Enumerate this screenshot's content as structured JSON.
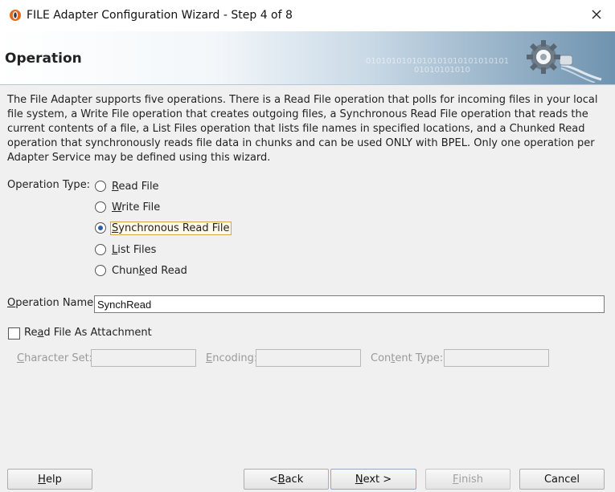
{
  "window": {
    "title": "FILE Adapter Configuration Wizard - Step 4 of 8"
  },
  "banner": {
    "title": "Operation",
    "binary": "0101010101010101010101010101",
    "binary2": "01010101010"
  },
  "description": "The File Adapter supports five operations.  There is a Read File operation that polls for incoming files in your local file system, a Write File operation that creates outgoing files, a Synchronous Read File operation that reads the current contents of a file, a List Files operation that lists file names in specified locations, and a Chunked Read operation that synchronously reads file data in chunks and can be used ONLY with BPEL. Only one operation per Adapter Service may be defined using this wizard.",
  "operation_type": {
    "label": "Operation Type:",
    "selected": "Synchronous Read File",
    "options": [
      {
        "mn": "R",
        "rest": "ead File"
      },
      {
        "mn": "W",
        "rest": "rite File"
      },
      {
        "mn": "S",
        "rest": "ynchronous Read File"
      },
      {
        "mn": "L",
        "rest": "ist Files"
      },
      {
        "pre": "Chun",
        "mn": "k",
        "rest": "ed Read"
      }
    ]
  },
  "operation_name": {
    "label_mn": "O",
    "label_rest": "peration Name:",
    "value": "SynchRead"
  },
  "attachment": {
    "label_pre": "Re",
    "label_mn": "a",
    "label_rest": "d File As Attachment",
    "checked": false
  },
  "character_set": {
    "label_mn": "C",
    "label_rest": "haracter Set:",
    "value": ""
  },
  "encoding": {
    "label_mn": "E",
    "label_rest": "ncoding:",
    "value": ""
  },
  "content_type": {
    "label_pre": "Con",
    "label_mn": "t",
    "label_rest": "ent Type:",
    "value": ""
  },
  "buttons": {
    "help": {
      "mn": "H",
      "rest": "elp"
    },
    "back": {
      "pre": "< ",
      "mn": "B",
      "rest": "ack"
    },
    "next": {
      "mn": "N",
      "rest": "ext >"
    },
    "finish": {
      "mn": "F",
      "rest": "inish"
    },
    "cancel": "Cancel"
  },
  "icons": [
    "oracle-app-icon",
    "close-icon",
    "gear-plug-icon"
  ]
}
